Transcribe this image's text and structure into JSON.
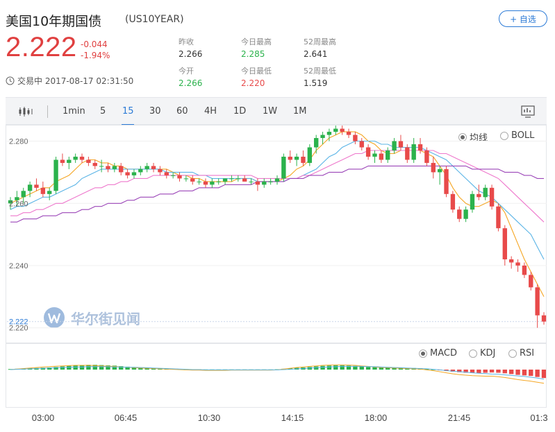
{
  "header": {
    "title": "美国10年期国债",
    "code": "(US10YEAR)",
    "watch_button": "+ 自选",
    "price": "2.222",
    "change": "-0.044",
    "change_pct": "-1.94%",
    "status": "交易中 2017-08-17 02:31:50"
  },
  "stats": [
    {
      "label": "昨收",
      "value": "2.266"
    },
    {
      "label": "今日最高",
      "value": "2.285"
    },
    {
      "label": "52周最高",
      "value": "2.641"
    },
    {
      "label": "今开",
      "value": "2.266"
    },
    {
      "label": "今日最低",
      "value": "2.220"
    },
    {
      "label": "52周最低",
      "value": "1.519"
    }
  ],
  "colors": {
    "up": "#2bb24c",
    "down": "#e84a4a",
    "accent": "#2b7ad6",
    "ma_orange": "#f5a623",
    "ma_blue": "#5ab4e6",
    "ma_pink": "#ee77cc",
    "ma_purple": "#9b45b8"
  },
  "toolbar": {
    "periods": [
      "1min",
      "5",
      "15",
      "30",
      "60",
      "4H",
      "1D",
      "1W",
      "1M"
    ],
    "active_period": "15"
  },
  "main_chart_options": [
    "均线",
    "BOLL"
  ],
  "main_chart_selected": "均线",
  "indicator_options": [
    "MACD",
    "KDJ",
    "RSI"
  ],
  "indicator_selected": "MACD",
  "watermark": "华尔街见闻",
  "chart_data": {
    "type": "candlestick",
    "y_ticks": [
      "2.280",
      "2.260",
      "2.240",
      "2.220"
    ],
    "current_price_label": "2.222",
    "ylim": [
      2.2157,
      2.2848
    ],
    "x_labels": [
      "03:00",
      "06:45",
      "10:30",
      "14:15",
      "18:00",
      "21:45",
      "01:3"
    ],
    "candles": [
      [
        2.26,
        2.262,
        2.258,
        2.261
      ],
      [
        2.261,
        2.264,
        2.259,
        2.262
      ],
      [
        2.262,
        2.265,
        2.26,
        2.264
      ],
      [
        2.264,
        2.267,
        2.262,
        2.266
      ],
      [
        2.266,
        2.268,
        2.264,
        2.265
      ],
      [
        2.265,
        2.267,
        2.262,
        2.263
      ],
      [
        2.263,
        2.265,
        2.261,
        2.264
      ],
      [
        2.264,
        2.275,
        2.263,
        2.274
      ],
      [
        2.274,
        2.276,
        2.272,
        2.273
      ],
      [
        2.273,
        2.275,
        2.271,
        2.274
      ],
      [
        2.274,
        2.276,
        2.273,
        2.275
      ],
      [
        2.275,
        2.276,
        2.273,
        2.274
      ],
      [
        2.274,
        2.275,
        2.272,
        2.273
      ],
      [
        2.273,
        2.274,
        2.271,
        2.272
      ],
      [
        2.272,
        2.274,
        2.27,
        2.272
      ],
      [
        2.272,
        2.273,
        2.27,
        2.271
      ],
      [
        2.271,
        2.273,
        2.27,
        2.272
      ],
      [
        2.272,
        2.273,
        2.269,
        2.27
      ],
      [
        2.27,
        2.271,
        2.268,
        2.269
      ],
      [
        2.269,
        2.271,
        2.268,
        2.27
      ],
      [
        2.27,
        2.272,
        2.269,
        2.271
      ],
      [
        2.271,
        2.273,
        2.27,
        2.272
      ],
      [
        2.272,
        2.273,
        2.27,
        2.271
      ],
      [
        2.271,
        2.272,
        2.269,
        2.27
      ],
      [
        2.27,
        2.271,
        2.268,
        2.269
      ],
      [
        2.269,
        2.27,
        2.268,
        2.269
      ],
      [
        2.269,
        2.27,
        2.267,
        2.268
      ],
      [
        2.268,
        2.269,
        2.267,
        2.268
      ],
      [
        2.268,
        2.269,
        2.266,
        2.267
      ],
      [
        2.267,
        2.268,
        2.266,
        2.267
      ],
      [
        2.267,
        2.268,
        2.265,
        2.266
      ],
      [
        2.266,
        2.268,
        2.265,
        2.267
      ],
      [
        2.267,
        2.268,
        2.266,
        2.267
      ],
      [
        2.267,
        2.268,
        2.266,
        2.268
      ],
      [
        2.268,
        2.269,
        2.267,
        2.268
      ],
      [
        2.268,
        2.269,
        2.267,
        2.268
      ],
      [
        2.268,
        2.269,
        2.267,
        2.267
      ],
      [
        2.267,
        2.268,
        2.266,
        2.267
      ],
      [
        2.267,
        2.268,
        2.264,
        2.266
      ],
      [
        2.266,
        2.268,
        2.265,
        2.267
      ],
      [
        2.267,
        2.268,
        2.266,
        2.267
      ],
      [
        2.267,
        2.269,
        2.266,
        2.268
      ],
      [
        2.268,
        2.276,
        2.267,
        2.275
      ],
      [
        2.275,
        2.277,
        2.273,
        2.274
      ],
      [
        2.274,
        2.276,
        2.272,
        2.275
      ],
      [
        2.275,
        2.277,
        2.272,
        2.273
      ],
      [
        2.273,
        2.279,
        2.272,
        2.278
      ],
      [
        2.278,
        2.282,
        2.276,
        2.281
      ],
      [
        2.281,
        2.283,
        2.279,
        2.282
      ],
      [
        2.282,
        2.284,
        2.28,
        2.283
      ],
      [
        2.283,
        2.285,
        2.282,
        2.284
      ],
      [
        2.284,
        2.285,
        2.282,
        2.283
      ],
      [
        2.283,
        2.284,
        2.281,
        2.282
      ],
      [
        2.282,
        2.283,
        2.279,
        2.28
      ],
      [
        2.28,
        2.281,
        2.277,
        2.278
      ],
      [
        2.278,
        2.279,
        2.274,
        2.275
      ],
      [
        2.275,
        2.277,
        2.273,
        2.276
      ],
      [
        2.276,
        2.277,
        2.273,
        2.274
      ],
      [
        2.274,
        2.278,
        2.273,
        2.277
      ],
      [
        2.277,
        2.281,
        2.276,
        2.28
      ],
      [
        2.28,
        2.282,
        2.277,
        2.278
      ],
      [
        2.278,
        2.279,
        2.273,
        2.274
      ],
      [
        2.274,
        2.281,
        2.273,
        2.279
      ],
      [
        2.279,
        2.281,
        2.276,
        2.277
      ],
      [
        2.277,
        2.278,
        2.272,
        2.273
      ],
      [
        2.273,
        2.275,
        2.268,
        2.27
      ],
      [
        2.27,
        2.272,
        2.266,
        2.271
      ],
      [
        2.271,
        2.272,
        2.262,
        2.263
      ],
      [
        2.263,
        2.264,
        2.257,
        2.258
      ],
      [
        2.258,
        2.259,
        2.254,
        2.255
      ],
      [
        2.255,
        2.259,
        2.254,
        2.258
      ],
      [
        2.258,
        2.264,
        2.257,
        2.263
      ],
      [
        2.263,
        2.266,
        2.261,
        2.262
      ],
      [
        2.262,
        2.266,
        2.261,
        2.265
      ],
      [
        2.265,
        2.266,
        2.258,
        2.259
      ],
      [
        2.259,
        2.26,
        2.251,
        2.252
      ],
      [
        2.252,
        2.253,
        2.24,
        2.242
      ],
      [
        2.242,
        2.243,
        2.239,
        2.241
      ],
      [
        2.241,
        2.242,
        2.238,
        2.24
      ],
      [
        2.24,
        2.241,
        2.236,
        2.237
      ],
      [
        2.237,
        2.238,
        2.232,
        2.233
      ],
      [
        2.233,
        2.234,
        2.22,
        2.224
      ],
      [
        2.224,
        2.225,
        2.221,
        2.222
      ]
    ],
    "ma_series": [
      {
        "color": "#f5a623",
        "values": [
          2.26,
          2.261,
          2.262,
          2.263,
          2.264,
          2.265,
          2.265,
          2.267,
          2.268,
          2.269,
          2.271,
          2.273,
          2.274,
          2.274,
          2.273,
          2.273,
          2.272,
          2.272,
          2.271,
          2.271,
          2.271,
          2.271,
          2.271,
          2.271,
          2.271,
          2.27,
          2.269,
          2.269,
          2.268,
          2.268,
          2.267,
          2.267,
          2.267,
          2.267,
          2.267,
          2.268,
          2.268,
          2.268,
          2.267,
          2.267,
          2.267,
          2.267,
          2.268,
          2.269,
          2.271,
          2.272,
          2.274,
          2.277,
          2.279,
          2.281,
          2.282,
          2.283,
          2.283,
          2.283,
          2.282,
          2.28,
          2.279,
          2.277,
          2.276,
          2.276,
          2.277,
          2.277,
          2.277,
          2.277,
          2.276,
          2.275,
          2.272,
          2.269,
          2.265,
          2.262,
          2.26,
          2.259,
          2.259,
          2.26,
          2.261,
          2.26,
          2.257,
          2.252,
          2.247,
          2.242,
          2.238,
          2.234,
          2.23
        ]
      },
      {
        "color": "#5ab4e6",
        "values": [
          2.258,
          2.259,
          2.259,
          2.26,
          2.261,
          2.262,
          2.262,
          2.263,
          2.264,
          2.265,
          2.266,
          2.268,
          2.269,
          2.27,
          2.271,
          2.271,
          2.271,
          2.271,
          2.271,
          2.271,
          2.271,
          2.271,
          2.271,
          2.271,
          2.27,
          2.27,
          2.27,
          2.27,
          2.27,
          2.269,
          2.269,
          2.268,
          2.268,
          2.268,
          2.268,
          2.268,
          2.268,
          2.268,
          2.267,
          2.267,
          2.267,
          2.267,
          2.267,
          2.268,
          2.268,
          2.269,
          2.27,
          2.271,
          2.273,
          2.275,
          2.276,
          2.278,
          2.279,
          2.28,
          2.28,
          2.28,
          2.28,
          2.279,
          2.279,
          2.278,
          2.278,
          2.278,
          2.278,
          2.278,
          2.277,
          2.276,
          2.275,
          2.274,
          2.272,
          2.27,
          2.268,
          2.266,
          2.264,
          2.263,
          2.262,
          2.26,
          2.258,
          2.256,
          2.254,
          2.252,
          2.25,
          2.246,
          2.242
        ]
      },
      {
        "color": "#ee77cc",
        "values": [
          2.256,
          2.256,
          2.257,
          2.257,
          2.258,
          2.258,
          2.259,
          2.26,
          2.26,
          2.261,
          2.262,
          2.263,
          2.264,
          2.265,
          2.265,
          2.266,
          2.266,
          2.267,
          2.267,
          2.268,
          2.268,
          2.268,
          2.269,
          2.269,
          2.269,
          2.269,
          2.269,
          2.269,
          2.269,
          2.269,
          2.269,
          2.269,
          2.269,
          2.269,
          2.269,
          2.269,
          2.269,
          2.269,
          2.268,
          2.268,
          2.268,
          2.268,
          2.268,
          2.268,
          2.268,
          2.269,
          2.269,
          2.27,
          2.271,
          2.272,
          2.273,
          2.274,
          2.275,
          2.276,
          2.276,
          2.277,
          2.277,
          2.277,
          2.277,
          2.277,
          2.277,
          2.277,
          2.277,
          2.277,
          2.277,
          2.277,
          2.276,
          2.276,
          2.275,
          2.274,
          2.273,
          2.272,
          2.271,
          2.27,
          2.269,
          2.268,
          2.266,
          2.264,
          2.262,
          2.26,
          2.258,
          2.256,
          2.254
        ]
      },
      {
        "color": "#9b45b8",
        "values": [
          2.254,
          2.254,
          2.255,
          2.255,
          2.255,
          2.256,
          2.256,
          2.256,
          2.257,
          2.257,
          2.257,
          2.258,
          2.258,
          2.259,
          2.259,
          2.26,
          2.26,
          2.26,
          2.261,
          2.261,
          2.262,
          2.262,
          2.262,
          2.263,
          2.263,
          2.263,
          2.264,
          2.264,
          2.264,
          2.265,
          2.265,
          2.265,
          2.265,
          2.266,
          2.266,
          2.266,
          2.266,
          2.266,
          2.267,
          2.267,
          2.267,
          2.267,
          2.267,
          2.268,
          2.268,
          2.268,
          2.269,
          2.269,
          2.269,
          2.27,
          2.27,
          2.27,
          2.271,
          2.271,
          2.271,
          2.272,
          2.272,
          2.272,
          2.272,
          2.272,
          2.272,
          2.272,
          2.272,
          2.272,
          2.272,
          2.272,
          2.272,
          2.272,
          2.272,
          2.272,
          2.272,
          2.271,
          2.271,
          2.271,
          2.271,
          2.271,
          2.27,
          2.27,
          2.27,
          2.269,
          2.269,
          2.268,
          2.268
        ]
      }
    ],
    "macd_hist": [
      0.2,
      0.3,
      0.4,
      0.5,
      0.6,
      0.7,
      0.8,
      1.0,
      1.2,
      1.4,
      1.6,
      1.7,
      1.8,
      1.8,
      1.7,
      1.6,
      1.5,
      1.3,
      1.1,
      0.9,
      0.8,
      0.7,
      0.6,
      0.5,
      0.4,
      0.3,
      0.2,
      0.1,
      0.1,
      0.1,
      0.05,
      0.05,
      0.05,
      0.05,
      0.05,
      0.05,
      0.05,
      0.05,
      0.05,
      0.05,
      0.05,
      0.1,
      0.3,
      0.5,
      0.7,
      0.8,
      1.0,
      1.2,
      1.4,
      1.5,
      1.6,
      1.6,
      1.5,
      1.4,
      1.2,
      1.0,
      0.9,
      0.8,
      0.8,
      0.8,
      0.7,
      0.6,
      0.6,
      0.5,
      0.3,
      0.1,
      -0.2,
      -0.5,
      -0.8,
      -1.0,
      -1.2,
      -1.3,
      -1.3,
      -1.2,
      -1.1,
      -1.2,
      -1.4,
      -1.7,
      -2.0,
      -2.2,
      -2.4,
      -2.8,
      -3.2
    ],
    "macd_dif": [
      0.0,
      0.2,
      0.4,
      0.6,
      0.8,
      1.0,
      1.1,
      1.3,
      1.4,
      1.5,
      1.6,
      1.6,
      1.6,
      1.5,
      1.4,
      1.3,
      1.2,
      1.0,
      0.9,
      0.7,
      0.6,
      0.5,
      0.4,
      0.3,
      0.2,
      0.1,
      0.0,
      -0.1,
      -0.2,
      -0.2,
      -0.3,
      -0.3,
      -0.3,
      -0.3,
      -0.2,
      -0.2,
      -0.2,
      -0.2,
      -0.2,
      -0.2,
      -0.2,
      -0.1,
      0.2,
      0.5,
      0.8,
      1.0,
      1.2,
      1.4,
      1.6,
      1.7,
      1.8,
      1.8,
      1.7,
      1.6,
      1.4,
      1.2,
      1.0,
      0.8,
      0.7,
      0.6,
      0.5,
      0.4,
      0.3,
      0.2,
      -0.1,
      -0.4,
      -0.8,
      -1.2,
      -1.6,
      -1.9,
      -2.1,
      -2.3,
      -2.4,
      -2.5,
      -2.5,
      -2.7,
      -3.0,
      -3.4,
      -3.8,
      -4.1,
      -4.4,
      -4.8,
      -5.2
    ],
    "macd_dea": [
      0.0,
      0.1,
      0.2,
      0.3,
      0.4,
      0.5,
      0.6,
      0.7,
      0.8,
      0.9,
      1.0,
      1.0,
      1.1,
      1.1,
      1.1,
      1.1,
      1.0,
      1.0,
      0.9,
      0.9,
      0.8,
      0.7,
      0.6,
      0.5,
      0.4,
      0.3,
      0.2,
      0.1,
      0.0,
      0.0,
      -0.1,
      -0.1,
      -0.1,
      -0.1,
      -0.1,
      -0.1,
      -0.1,
      -0.1,
      -0.1,
      -0.1,
      -0.1,
      -0.1,
      0.0,
      0.1,
      0.3,
      0.4,
      0.6,
      0.7,
      0.9,
      1.0,
      1.1,
      1.2,
      1.2,
      1.2,
      1.2,
      1.1,
      1.1,
      1.0,
      0.9,
      0.8,
      0.7,
      0.6,
      0.5,
      0.4,
      0.3,
      0.1,
      -0.1,
      -0.4,
      -0.6,
      -0.8,
      -1.0,
      -1.2,
      -1.4,
      -1.5,
      -1.7,
      -1.8,
      -2.0,
      -2.2,
      -2.4,
      -2.6,
      -2.9,
      -3.2,
      -3.6
    ]
  }
}
